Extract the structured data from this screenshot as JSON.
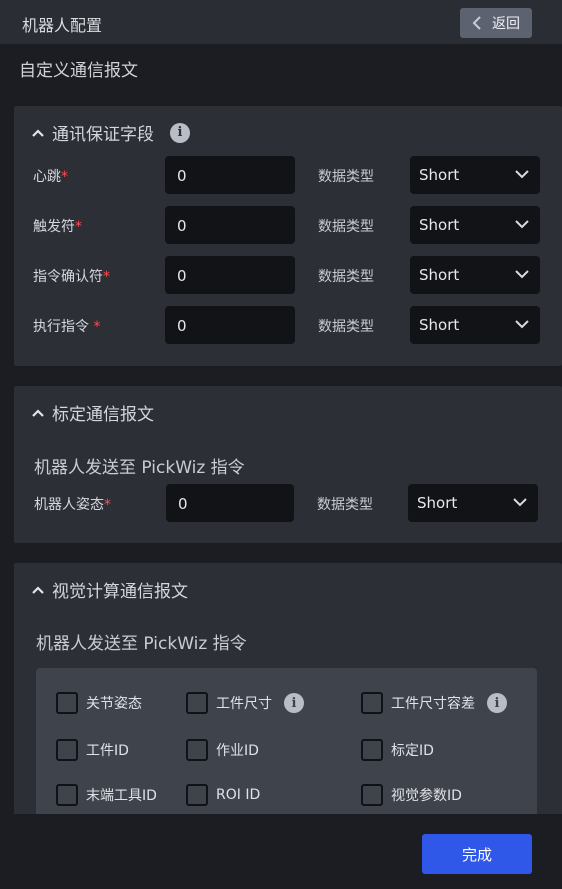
{
  "header": {
    "title": "机器人配置",
    "back_label": "返回"
  },
  "section_title": "自定义通信报文",
  "panel1": {
    "title": "通讯保证字段",
    "rows": [
      {
        "label": "心跳",
        "required": "*",
        "value": "0",
        "type_label": "数据类型",
        "type_value": "Short"
      },
      {
        "label": "触发符",
        "required": "*",
        "value": "0",
        "type_label": "数据类型",
        "type_value": "Short"
      },
      {
        "label": "指令确认符",
        "required": "*",
        "value": "0",
        "type_label": "数据类型",
        "type_value": "Short"
      },
      {
        "label": "执行指令 ",
        "required": "*",
        "value": "0",
        "type_label": "数据类型",
        "type_value": "Short"
      }
    ]
  },
  "panel2": {
    "title": "标定通信报文",
    "sub_title": "机器人发送至 PickWiz 指令",
    "rows": [
      {
        "label": "机器人姿态",
        "required": "*",
        "value": "0",
        "type_label": "数据类型",
        "type_value": "Short"
      }
    ]
  },
  "panel3": {
    "title": "视觉计算通信报文",
    "sub_title": "机器人发送至 PickWiz 指令",
    "checkboxes": [
      {
        "label": "关节姿态",
        "checked": false
      },
      {
        "label": "工件尺寸",
        "checked": false
      },
      {
        "label": "工件尺寸容差",
        "checked": false
      },
      {
        "label": "工件ID",
        "checked": false
      },
      {
        "label": "作业ID",
        "checked": false
      },
      {
        "label": "标定ID",
        "checked": false
      },
      {
        "label": "末端工具ID",
        "checked": false
      },
      {
        "label": "ROI ID",
        "checked": false
      },
      {
        "label": "视觉参数ID",
        "checked": false
      }
    ]
  },
  "footer": {
    "done_label": "完成"
  },
  "colors": {
    "accent": "#2f57e8",
    "required": "#ff4d4f",
    "panel": "#2c2f36",
    "background": "#1b1d22"
  },
  "icons": {
    "back": "chevron-left-icon",
    "collapse": "chevron-up-icon",
    "dropdown": "chevron-down-icon",
    "info": "info-icon"
  }
}
